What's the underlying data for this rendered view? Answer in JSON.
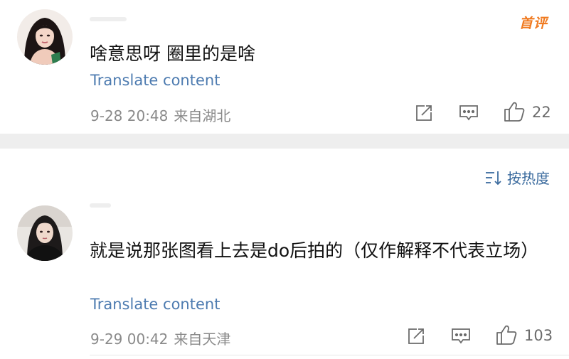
{
  "comments": [
    {
      "badge": "首评",
      "text": "啥意思呀 圈里的是啥",
      "translate_label": "Translate content",
      "time": "9-28 20:48",
      "location": "来自湖北",
      "like_count": "22"
    },
    {
      "text": "就是说那张图看上去是do后拍的（仅作解释不代表立场）",
      "translate_label": "Translate content",
      "time": "9-29 00:42",
      "location": "来自天津",
      "like_count": "103"
    }
  ],
  "sort": {
    "label": "按热度"
  },
  "icons": {
    "share": "share-icon",
    "reply": "comment-icon",
    "like": "thumbs-up-icon",
    "sort": "sort-icon"
  },
  "colors": {
    "link": "#4d7bb0",
    "badge": "#f07a20",
    "meta": "#8a8a8a",
    "divider_band": "#eeeeee"
  }
}
